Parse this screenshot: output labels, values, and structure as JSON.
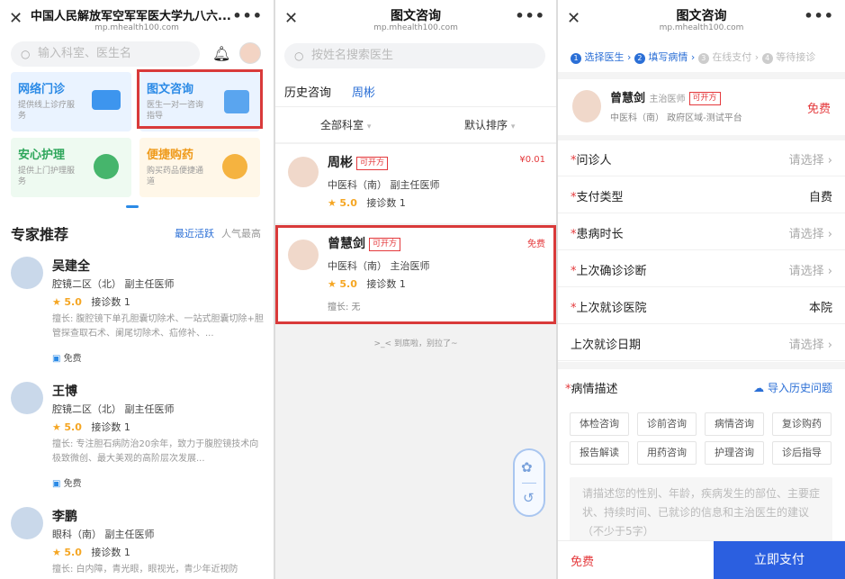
{
  "p1": {
    "title": "中国人民解放军空军军医大学九八六...",
    "domain": "mp.mhealth100.com",
    "search_placeholder": "输入科室、医生名",
    "services": [
      {
        "title": "网络门诊",
        "desc": "提供线上诊疗服务"
      },
      {
        "title": "图文咨询",
        "desc": "医生一对一咨询指导"
      },
      {
        "title": "安心护理",
        "desc": "提供上门护理服务"
      },
      {
        "title": "便捷购药",
        "desc": "购买药品便捷通道"
      }
    ],
    "section_title": "专家推荐",
    "sort_recent": "最近活跃",
    "sort_popular": "人气最高",
    "doctors": [
      {
        "name": "吴建全",
        "dept": "腔镜二区（北）  副主任医师",
        "rating": "5.0",
        "consults": "接诊数 1",
        "skill": "擅长: 腹腔镜下单孔胆囊切除术、一站式胆囊切除+胆管探查取石术、阑尾切除术、疝修补、...",
        "fee": "免费"
      },
      {
        "name": "王博",
        "dept": "腔镜二区（北）  副主任医师",
        "rating": "5.0",
        "consults": "接诊数 1",
        "skill": "擅长: 专注胆石病防治20余年，致力于腹腔镜技术向极致微创、最大美观的高阶层次发展...",
        "fee": "免费"
      },
      {
        "name": "李鹏",
        "dept": "眼科（南）  副主任医师",
        "rating": "5.0",
        "consults": "接诊数 1",
        "skill": "擅长: 白内障，青光眼，眼视光，青少年近视防"
      }
    ]
  },
  "p2": {
    "title": "图文咨询",
    "domain": "mp.mhealth100.com",
    "search_placeholder": "按姓名搜索医生",
    "tab_history": "历史咨询",
    "tab_name": "周彬",
    "filter_dept": "全部科室",
    "filter_sort": "默认排序",
    "doctors": [
      {
        "name": "周彬",
        "badge": "可开方",
        "price": "¥0.01",
        "dept": "中医科（南）  副主任医师",
        "rating": "5.0",
        "consults": "接诊数 1"
      },
      {
        "name": "曾慧剑",
        "badge": "可开方",
        "price": "免费",
        "dept": "中医科（南）  主治医师",
        "rating": "5.0",
        "consults": "接诊数 1",
        "skill": "擅长: 无"
      }
    ],
    "end_text": ">_<  到底啦，别拉了~"
  },
  "p3": {
    "title": "图文咨询",
    "domain": "mp.mhealth100.com",
    "steps": [
      {
        "num": "1",
        "label": "选择医生"
      },
      {
        "num": "2",
        "label": "填写病情"
      },
      {
        "num": "3",
        "label": "在线支付"
      },
      {
        "num": "4",
        "label": "等待接诊"
      }
    ],
    "doctor": {
      "name": "曾慧剑",
      "title": "主治医师",
      "badge": "可开方",
      "dept": "中医科（南）  政府区域-测试平台",
      "price": "免费"
    },
    "fields": [
      {
        "label": "问诊人",
        "value": "请选择 ›",
        "required": "*"
      },
      {
        "label": "支付类型",
        "value": "自费",
        "required": "*"
      },
      {
        "label": "患病时长",
        "value": "请选择 ›",
        "required": "*"
      },
      {
        "label": "上次确诊诊断",
        "value": "请选择 ›",
        "required": "*"
      },
      {
        "label": "上次就诊医院",
        "value": "本院",
        "required": "*"
      },
      {
        "label": "上次就诊日期",
        "value": "请选择 ›",
        "required": ""
      }
    ],
    "desc_label": "病情描述",
    "import_label": "导入历史问题",
    "tags": [
      "体检咨询",
      "诊前咨询",
      "病情咨询",
      "复诊购药",
      "报告解读",
      "用药咨询",
      "护理咨询",
      "诊后指导"
    ],
    "placeholder": "请描述您的性别、年龄，疾病发生的部位、主要症状、持续时间、已就诊的信息和主治医生的建议（不少于5字）",
    "footer_price": "免费",
    "pay_button": "立即支付"
  }
}
